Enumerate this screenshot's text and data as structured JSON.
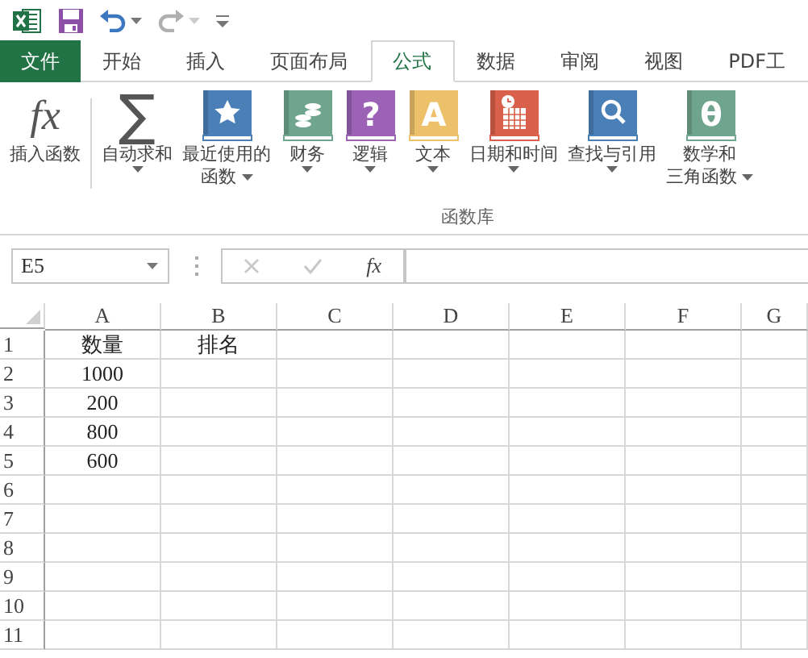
{
  "quick_access": [
    {
      "kind": "app"
    },
    {
      "kind": "save"
    },
    {
      "kind": "undo",
      "disabled": false
    },
    {
      "kind": "redo",
      "disabled": true
    },
    {
      "kind": "customize"
    }
  ],
  "tabs": [
    {
      "label": "文件",
      "kind": "file",
      "selected": false
    },
    {
      "label": "开始",
      "kind": "tab",
      "selected": false
    },
    {
      "label": "插入",
      "kind": "tab",
      "selected": false
    },
    {
      "label": "页面布局",
      "kind": "tab",
      "selected": false
    },
    {
      "label": "公式",
      "kind": "tab",
      "selected": true
    },
    {
      "label": "数据",
      "kind": "tab",
      "selected": false
    },
    {
      "label": "审阅",
      "kind": "tab",
      "selected": false
    },
    {
      "label": "视图",
      "kind": "tab",
      "selected": false
    },
    {
      "label": "PDF工",
      "kind": "tab",
      "selected": false
    }
  ],
  "ribbon": {
    "group_label": "函数库",
    "buttons": [
      {
        "kind": "fx",
        "glyph": "fx",
        "lines": [
          "插入函数"
        ],
        "has_menu": false
      },
      {
        "kind": "sum",
        "glyph": "∑",
        "lines": [
          "自动求和"
        ],
        "has_menu": true
      },
      {
        "kind": "star",
        "color": "#4a7fb8",
        "lines": [
          "最近使用的",
          "函数"
        ],
        "has_menu": true
      },
      {
        "kind": "coins",
        "color": "#6fa58e",
        "lines": [
          "财务"
        ],
        "has_menu": true
      },
      {
        "kind": "letter",
        "color": "#9b62b5",
        "glyph": "?",
        "lines": [
          "逻辑"
        ],
        "has_menu": true
      },
      {
        "kind": "letter",
        "color": "#edc06a",
        "glyph": "A",
        "lines": [
          "文本"
        ],
        "has_menu": true
      },
      {
        "kind": "calendar",
        "color": "#d9604a",
        "lines": [
          "日期和时间"
        ],
        "has_menu": true
      },
      {
        "kind": "search",
        "color": "#4a7fb8",
        "lines": [
          "查找与引用"
        ],
        "has_menu": true
      },
      {
        "kind": "letter",
        "color": "#6fa58e",
        "glyph": "θ",
        "lines": [
          "数学和",
          "三角函数"
        ],
        "has_menu": true
      }
    ]
  },
  "formula_bar": {
    "name_box": "E5",
    "fx": "fx"
  },
  "sheet": {
    "columns": [
      "A",
      "B",
      "C",
      "D",
      "E",
      "F",
      "G"
    ],
    "rows": [
      {
        "number": "1",
        "cells": [
          "数量",
          "排名"
        ]
      },
      {
        "number": "2",
        "cells": [
          "1000"
        ]
      },
      {
        "number": "3",
        "cells": [
          "200"
        ]
      },
      {
        "number": "4",
        "cells": [
          "800"
        ]
      },
      {
        "number": "5",
        "cells": [
          "600"
        ]
      },
      {
        "number": "6",
        "cells": []
      },
      {
        "number": "7",
        "cells": []
      },
      {
        "number": "8",
        "cells": []
      },
      {
        "number": "9",
        "cells": []
      },
      {
        "number": "10",
        "cells": []
      },
      {
        "number": "11",
        "cells": []
      }
    ]
  }
}
